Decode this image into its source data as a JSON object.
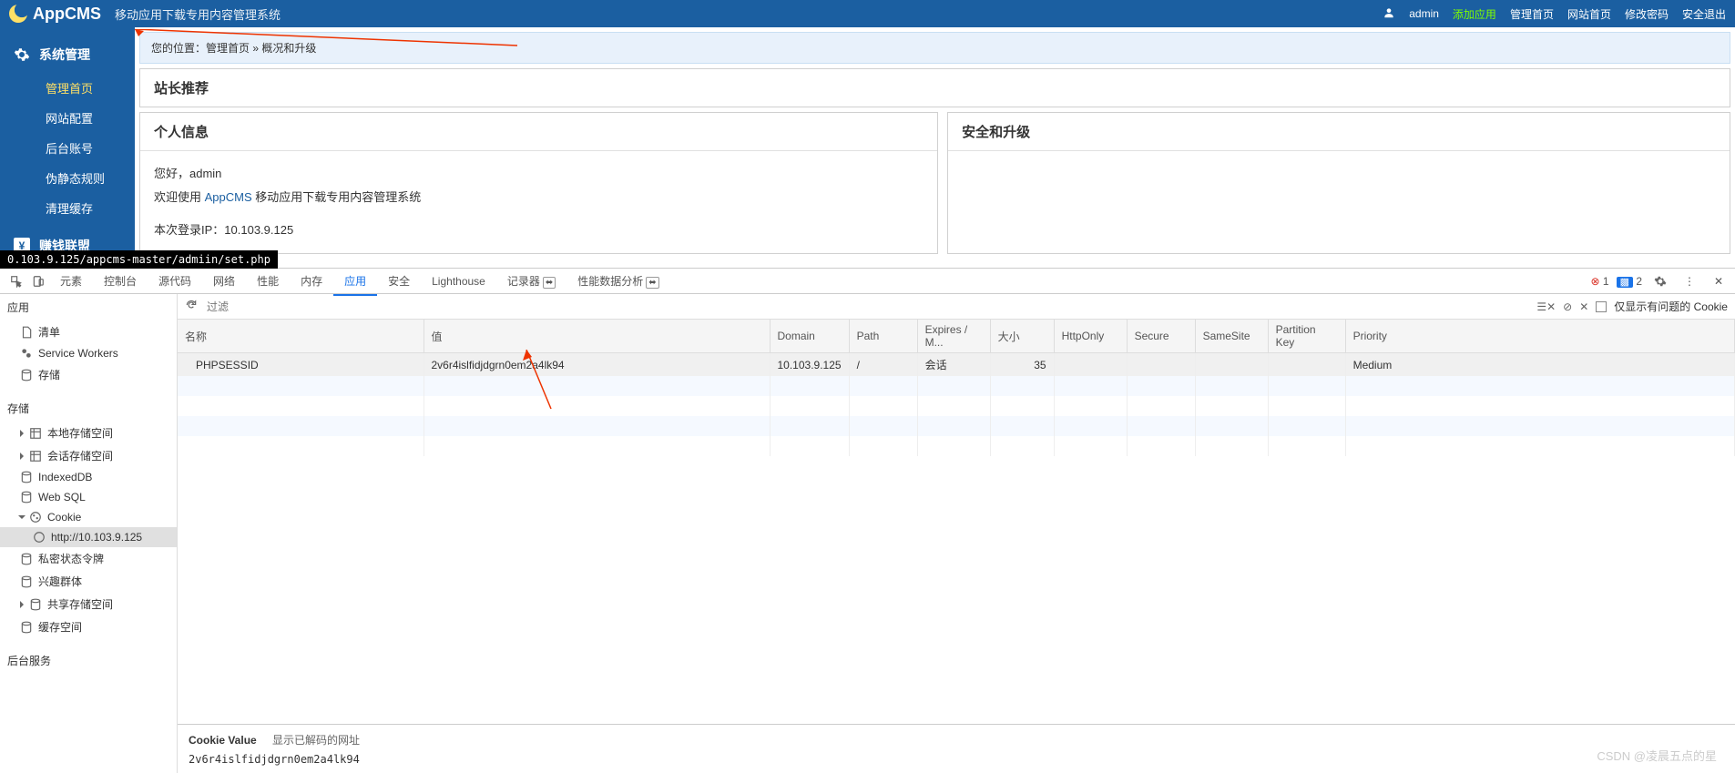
{
  "header": {
    "logo": "AppCMS",
    "subtitle": "移动应用下载专用内容管理系统",
    "user_icon": "user",
    "username": "admin",
    "links": {
      "add_app": "添加应用",
      "admin_home": "管理首页",
      "site_home": "网站首页",
      "change_pwd": "修改密码",
      "logout": "安全退出"
    }
  },
  "sidebar": {
    "group1_label": "系统管理",
    "items": [
      {
        "label": "管理首页",
        "active": true
      },
      {
        "label": "网站配置",
        "active": false
      },
      {
        "label": "后台账号",
        "active": false
      },
      {
        "label": "伪静态规则",
        "active": false
      },
      {
        "label": "清理缓存",
        "active": false
      }
    ],
    "group2_label": "赚钱联盟"
  },
  "breadcrumb": {
    "prefix": "您的位置：",
    "home": "管理首页",
    "sep": " » ",
    "current": "概况和升级"
  },
  "panels": {
    "recommend_title": "站长推荐",
    "info_title": "个人信息",
    "info_hello": "您好，admin",
    "info_welcome_pre": "欢迎使用 ",
    "info_welcome_link": "AppCMS",
    "info_welcome_post": " 移动应用下载专用内容管理系统",
    "info_ip_label": "本次登录IP：",
    "info_ip_value": "10.103.9.125",
    "security_title": "安全和升级"
  },
  "url_tooltip": "0.103.9.125/appcms-master/admiin/set.php",
  "devtools": {
    "tabs": [
      "元素",
      "控制台",
      "源代码",
      "网络",
      "性能",
      "内存",
      "应用",
      "安全",
      "Lighthouse",
      "记录器",
      "性能数据分析"
    ],
    "active_tab": "应用",
    "beta_tabs": [
      "记录器",
      "性能数据分析"
    ],
    "error_count": "1",
    "info_count": "2",
    "left_panel": {
      "section_app": "应用",
      "app_items": [
        "清单",
        "Service Workers",
        "存储"
      ],
      "section_storage": "存储",
      "storage_items": [
        "本地存储空间",
        "会话存储空间",
        "IndexedDB",
        "Web SQL"
      ],
      "cookie_label": "Cookie",
      "cookie_url": "http://10.103.9.125",
      "extra_items": [
        "私密状态令牌",
        "兴趣群体",
        "共享存储空间",
        "缓存空间"
      ],
      "section_bg": "后台服务"
    },
    "toolbar": {
      "filter_placeholder": "过滤",
      "only_issues_label": "仅显示有问题的 Cookie"
    },
    "table": {
      "headers": [
        "名称",
        "值",
        "Domain",
        "Path",
        "Expires / M...",
        "大小",
        "HttpOnly",
        "Secure",
        "SameSite",
        "Partition Key",
        "Priority"
      ],
      "row": {
        "name": "PHPSESSID",
        "value": "2v6r4islfidjdgrn0em2a4lk94",
        "domain": "10.103.9.125",
        "path": "/",
        "expires": "会话",
        "size": "35",
        "httponly": "",
        "secure": "",
        "samesite": "",
        "partition": "",
        "priority": "Medium"
      }
    },
    "detail": {
      "label": "Cookie Value",
      "decode_label": "显示已解码的网址",
      "value": "2v6r4islfidjdgrn0em2a4lk94"
    }
  },
  "watermark": "CSDN @凌晨五点的星"
}
